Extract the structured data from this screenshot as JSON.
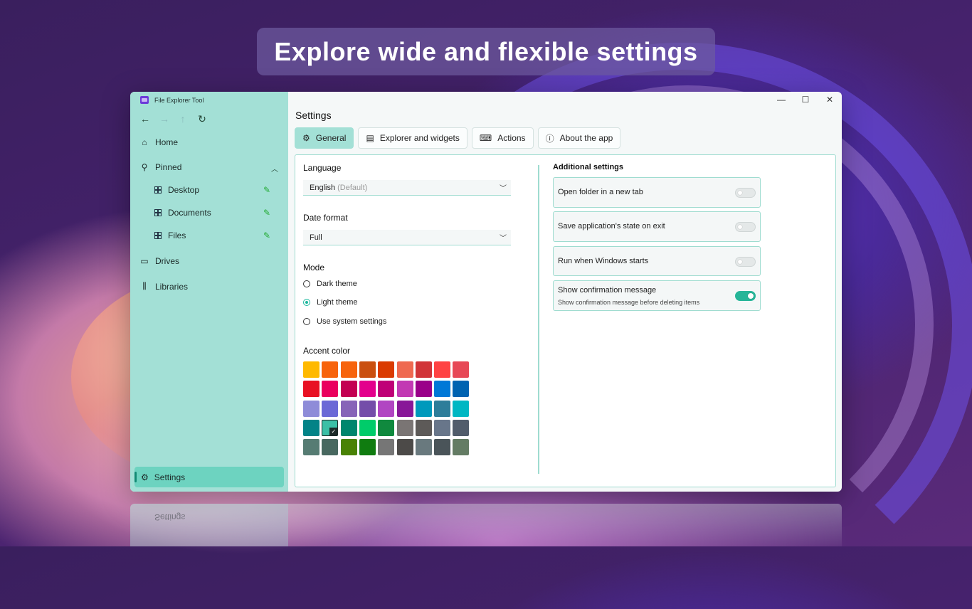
{
  "banner": {
    "text": "Explore wide and flexible settings"
  },
  "window": {
    "app_title": "File Explorer Tool",
    "controls": {
      "minimize": "—",
      "maximize": "☐",
      "close": "✕"
    }
  },
  "nav": {
    "back": "←",
    "forward": "→",
    "up": "↑",
    "refresh": "↻"
  },
  "sidebar": {
    "home": "Home",
    "pinned": "Pinned",
    "pinned_items": [
      "Desktop",
      "Documents",
      "Files"
    ],
    "drives": "Drives",
    "libraries": "Libraries",
    "settings": "Settings"
  },
  "main": {
    "title": "Settings",
    "tabs": [
      {
        "label": "General",
        "icon": "gear-icon",
        "active": true
      },
      {
        "label": "Explorer and widgets",
        "icon": "folder-window-icon",
        "active": false
      },
      {
        "label": "Actions",
        "icon": "keyboard-icon",
        "active": false
      },
      {
        "label": "About the app",
        "icon": "info-icon",
        "active": false
      }
    ]
  },
  "general": {
    "language_label": "Language",
    "language_value": "English",
    "language_suffix": "(Default)",
    "date_format_label": "Date format",
    "date_format_value": "Full",
    "mode_label": "Mode",
    "modes": [
      "Dark theme",
      "Light theme",
      "Use system settings"
    ],
    "selected_mode": "Light theme",
    "accent_label": "Accent color",
    "accent_colors": [
      [
        "#ffb900",
        "#f7630c",
        "#f7630c",
        "#ca5010",
        "#da3b01",
        "#ef6950",
        "#d13438",
        "#ff4343",
        "#e74856"
      ],
      [
        "#e81123",
        "#ea005e",
        "#c30052",
        "#e3008c",
        "#bf0077",
        "#c239b3",
        "#9a0089",
        "#0078d7",
        "#0063b1"
      ],
      [
        "#8e8cd8",
        "#6b69d6",
        "#8764b8",
        "#744da9",
        "#b146c2",
        "#881798",
        "#0099bc",
        "#2d7d9a",
        "#00b7c3"
      ],
      [
        "#038387",
        "#3bbfa6",
        "#00866e",
        "#00cc6a",
        "#10893e",
        "#7a7574",
        "#5d5a58",
        "#68768a",
        "#515c6b"
      ],
      [
        "#567c73",
        "#486860",
        "#498205",
        "#107c10",
        "#767676",
        "#4c4a48",
        "#69797e",
        "#4a5459",
        "#647c64"
      ]
    ],
    "selected_accent": "#3bbfa6"
  },
  "additional": {
    "title": "Additional settings",
    "items": [
      {
        "title": "Open folder in a new tab",
        "desc": "",
        "on": false
      },
      {
        "title": "Save application's state on exit",
        "desc": "",
        "on": false
      },
      {
        "title": "Run when Windows starts",
        "desc": "",
        "on": false
      },
      {
        "title": "Show confirmation message",
        "desc": "Show confirmation message before deleting items",
        "on": true
      }
    ]
  },
  "colors": {
    "sidebar": "#a3e0d6",
    "accent": "#26b598",
    "selected_nav": "#6dd3c0"
  }
}
